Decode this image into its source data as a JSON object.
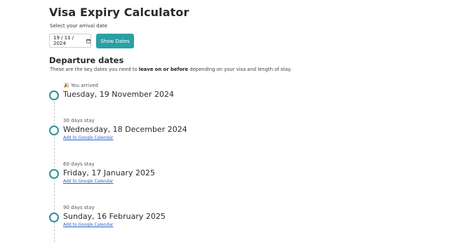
{
  "app": {
    "title": "Visa Expiry Calculator"
  },
  "arrival": {
    "label": "Select your arrival date",
    "value": "19 / 11 / 2024",
    "button_label": "Show Dates"
  },
  "departure": {
    "title": "Departure dates",
    "desc_before": "These are the key dates you need to ",
    "desc_bold": "leave on or before",
    "desc_after": " depending on your visa and length of stay."
  },
  "timeline": [
    {
      "label": "You arrived",
      "emoji": "🎉",
      "date": "Tuesday, 19 November 2024",
      "link": ""
    },
    {
      "label": "30 days stay",
      "date": "Wednesday, 18 December 2024",
      "link": "Add to Google Calendar"
    },
    {
      "label": "60 days stay",
      "date": "Friday, 17 January 2025",
      "link": "Add to Google Calendar"
    },
    {
      "label": "90 days stay",
      "date": "Sunday, 16 February 2025",
      "link": "Add to Google Calendar"
    }
  ],
  "colors": {
    "accent": "#2aa0a6",
    "circle": "#2f8f9a",
    "link": "#2b63c6"
  },
  "icons": {
    "calendar": "calendar-icon",
    "party": "party-popper-icon"
  }
}
